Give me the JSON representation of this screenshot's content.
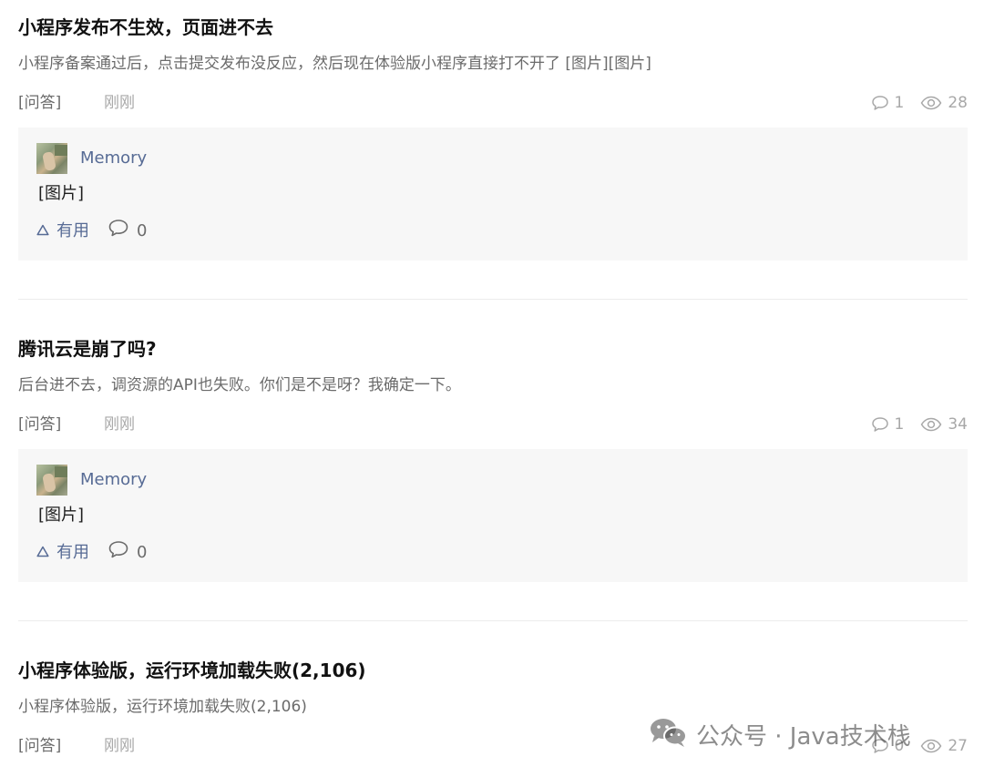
{
  "posts": [
    {
      "title": "小程序发布不生效，页面进不去",
      "excerpt": "小程序备案通过后，点击提交发布没反应，然后现在体验版小程序直接打不开了 [图片][图片]",
      "tag": "[问答]",
      "time": "刚刚",
      "comments": "1",
      "views": "28",
      "reply": {
        "user": "Memory",
        "content": "[图片]",
        "useful_label": "有用",
        "comment_count": "0"
      }
    },
    {
      "title": "腾讯云是崩了吗?",
      "excerpt": "后台进不去，调资源的API也失败。你们是不是呀？我确定一下。",
      "tag": "[问答]",
      "time": "刚刚",
      "comments": "1",
      "views": "34",
      "reply": {
        "user": "Memory",
        "content": "[图片]",
        "useful_label": "有用",
        "comment_count": "0"
      }
    },
    {
      "title": "小程序体验版，运行环境加载失败(2,106)",
      "excerpt": "小程序体验版，运行环境加载失败(2,106)",
      "tag": "[问答]",
      "time": "刚刚",
      "comments": "0",
      "views": "27"
    }
  ],
  "watermark": {
    "text": "公众号 · Java技术栈"
  },
  "icons": {
    "comment": "comment-bubble-icon",
    "view": "eye-icon",
    "useful": "triangle-up-icon",
    "wechat": "wechat-icon"
  },
  "colors": {
    "link": "#576b95",
    "muted": "#a8a8a8",
    "reply_bg": "#f7f7f7"
  }
}
